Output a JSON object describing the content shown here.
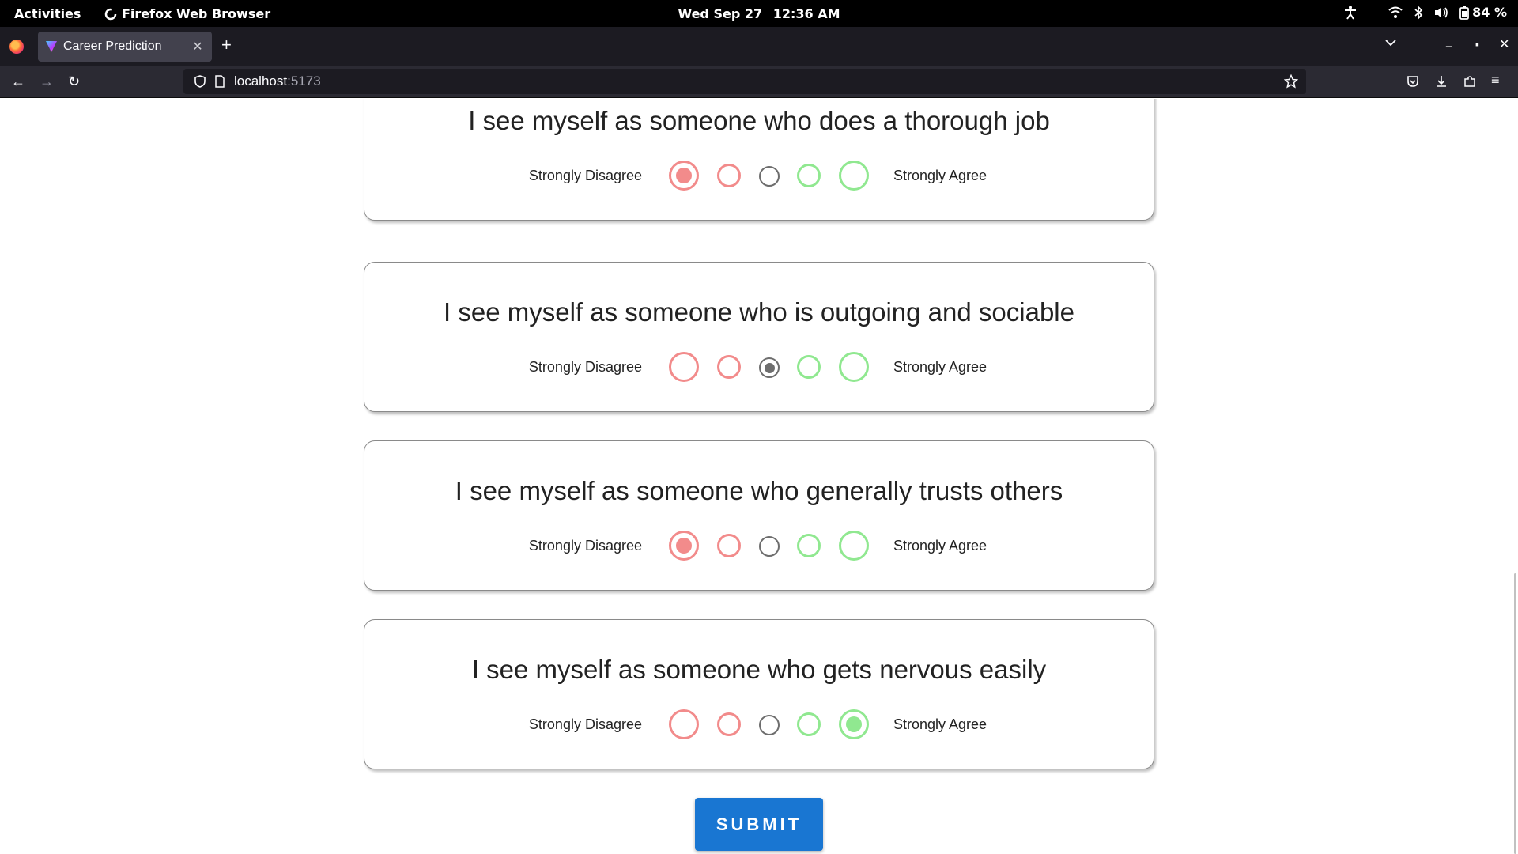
{
  "system": {
    "activities": "Activities",
    "app_name": "Firefox Web Browser",
    "date": "Wed Sep 27",
    "time": "12:36 AM",
    "battery": "84 %"
  },
  "browser": {
    "tab_title": "Career Prediction",
    "url_host": "localhost",
    "url_port": ":5173"
  },
  "survey": {
    "scale_left": "Strongly Disagree",
    "scale_right": "Strongly Agree",
    "questions": [
      {
        "text": "I see myself as someone who does a thorough job",
        "selected": 1
      },
      {
        "text": "I see myself as someone who is outgoing and sociable",
        "selected": 3
      },
      {
        "text": "I see myself as someone who generally trusts others",
        "selected": 1
      },
      {
        "text": "I see myself as someone who gets nervous easily",
        "selected": 5
      }
    ],
    "submit_label": "SUBMIT"
  },
  "colors": {
    "disagree": "#f28b8b",
    "neutral": "#6e6e6e",
    "agree": "#90e890",
    "submit": "#1976d2"
  }
}
